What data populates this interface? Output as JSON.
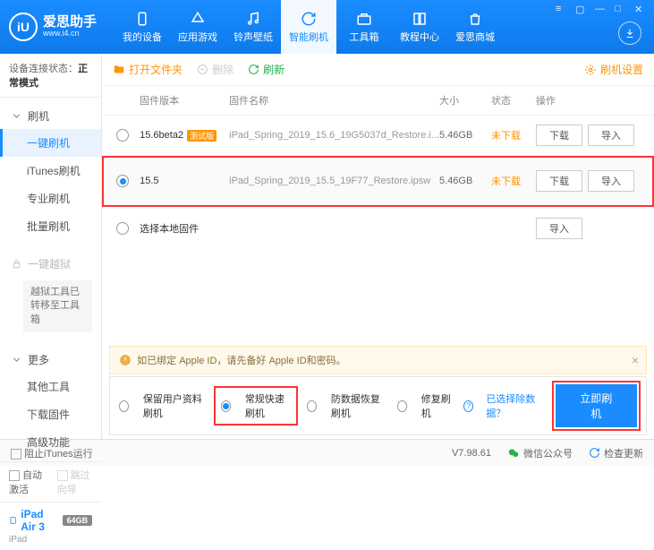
{
  "logo": {
    "title": "爱思助手",
    "url": "www.i4.cn",
    "mark": "iU"
  },
  "nav": [
    {
      "label": "我的设备"
    },
    {
      "label": "应用游戏"
    },
    {
      "label": "铃声壁纸"
    },
    {
      "label": "智能刷机"
    },
    {
      "label": "工具箱"
    },
    {
      "label": "教程中心"
    },
    {
      "label": "爱思商城"
    }
  ],
  "status": {
    "label": "设备连接状态：",
    "value": "正常模式"
  },
  "sidebar": {
    "flash": {
      "head": "刷机",
      "items": [
        "一键刷机",
        "iTunes刷机",
        "专业刷机",
        "批量刷机"
      ]
    },
    "jailbreak": {
      "head": "一键越狱",
      "note": "越狱工具已转移至工具箱"
    },
    "more": {
      "head": "更多",
      "items": [
        "其他工具",
        "下载固件",
        "高级功能"
      ]
    },
    "auto_activate": "自动激活",
    "skip_guide": "跳过向导",
    "device": {
      "name": "iPad Air 3",
      "storage": "64GB",
      "type": "iPad"
    }
  },
  "toolbar": {
    "open": "打开文件夹",
    "delete": "删除",
    "refresh": "刷新",
    "settings": "刷机设置"
  },
  "columns": {
    "ver": "固件版本",
    "name": "固件名称",
    "size": "大小",
    "status": "状态",
    "ops": "操作"
  },
  "rows": [
    {
      "ver": "15.6beta2",
      "beta": "测试版",
      "fname": "iPad_Spring_2019_15.6_19G5037d_Restore.i...",
      "size": "5.46GB",
      "status": "未下载",
      "dl": "下载",
      "imp": "导入",
      "selected": false
    },
    {
      "ver": "15.5",
      "fname": "iPad_Spring_2019_15.5_19F77_Restore.ipsw",
      "size": "5.46GB",
      "status": "未下载",
      "dl": "下载",
      "imp": "导入",
      "selected": true
    }
  ],
  "local_row": {
    "label": "选择本地固件",
    "imp": "导入"
  },
  "warning": "如已绑定 Apple ID，请先备好 Apple ID和密码。",
  "options": {
    "keep_data": "保留用户资料刷机",
    "normal": "常规快速刷机",
    "antirecover": "防数据恢复刷机",
    "repair": "修复刷机",
    "exclude": "已选择除数据？",
    "go": "立即刷机"
  },
  "footer": {
    "block": "阻止iTunes运行",
    "version": "V7.98.61",
    "wechat": "微信公众号",
    "update": "检查更新"
  }
}
